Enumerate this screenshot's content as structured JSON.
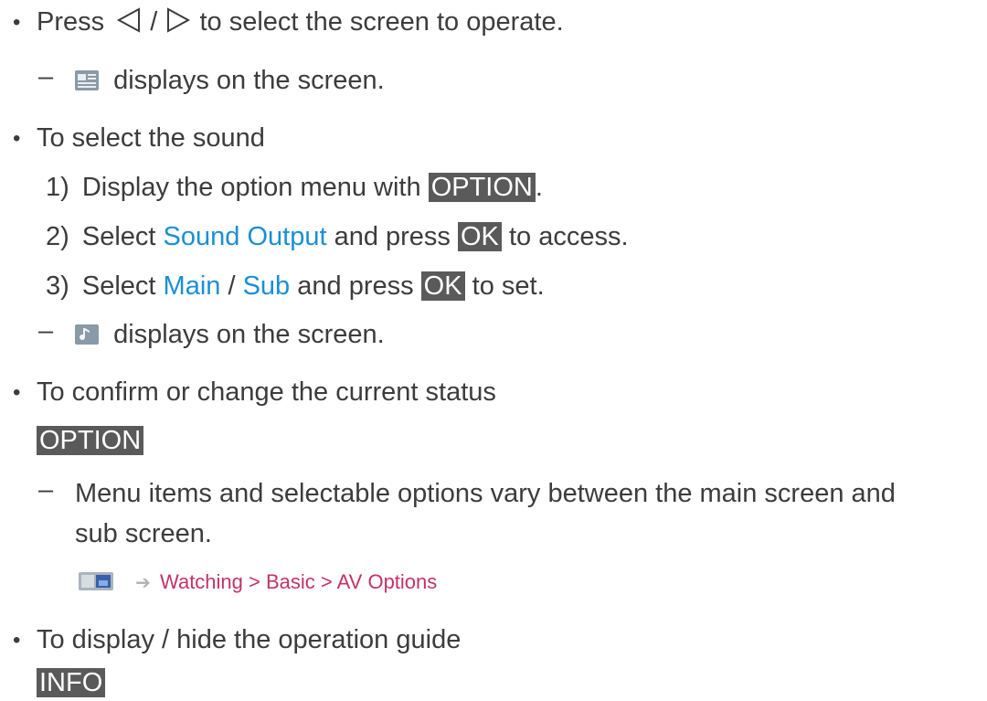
{
  "items": {
    "press_before": "Press",
    "slash": "/",
    "press_after": "to select the screen to operate.",
    "displays_on_screen_1": "displays on the screen.",
    "select_sound_title": "To select the sound",
    "step1_num": "1)",
    "step1_text": "Display the option menu with",
    "step1_btn": "OPTION",
    "step1_end": ".",
    "step2_num": "2)",
    "step2_text": "Select",
    "step2_link": "Sound Output",
    "step2_mid": "and press",
    "step2_btn": "OK",
    "step2_end": "to access.",
    "step3_num": "3)",
    "step3_text": "Select",
    "step3_main": "Main",
    "step3_slash": "/",
    "step3_sub": "Sub",
    "step3_mid": "and press",
    "step3_btn": "OK",
    "step3_end": "to set.",
    "displays_on_screen_2": "displays on the screen.",
    "confirm_title": "To confirm or change the current status",
    "option_btn": "OPTION",
    "note_line1": "Menu items and selectable options vary between the main screen and",
    "note_line2": "sub screen.",
    "crumb_path": "Watching > Basic > AV Options",
    "guide_title": "To display / hide the operation guide",
    "info_btn": "INFO"
  },
  "symbols": {
    "bullet": "•",
    "dash": "–",
    "arrow": "➔"
  },
  "colors": {
    "text": "#3c3c3c",
    "button_bg": "#5a5a5a",
    "link_blue": "#1a8fd6",
    "crumb_pink": "#c33366"
  }
}
